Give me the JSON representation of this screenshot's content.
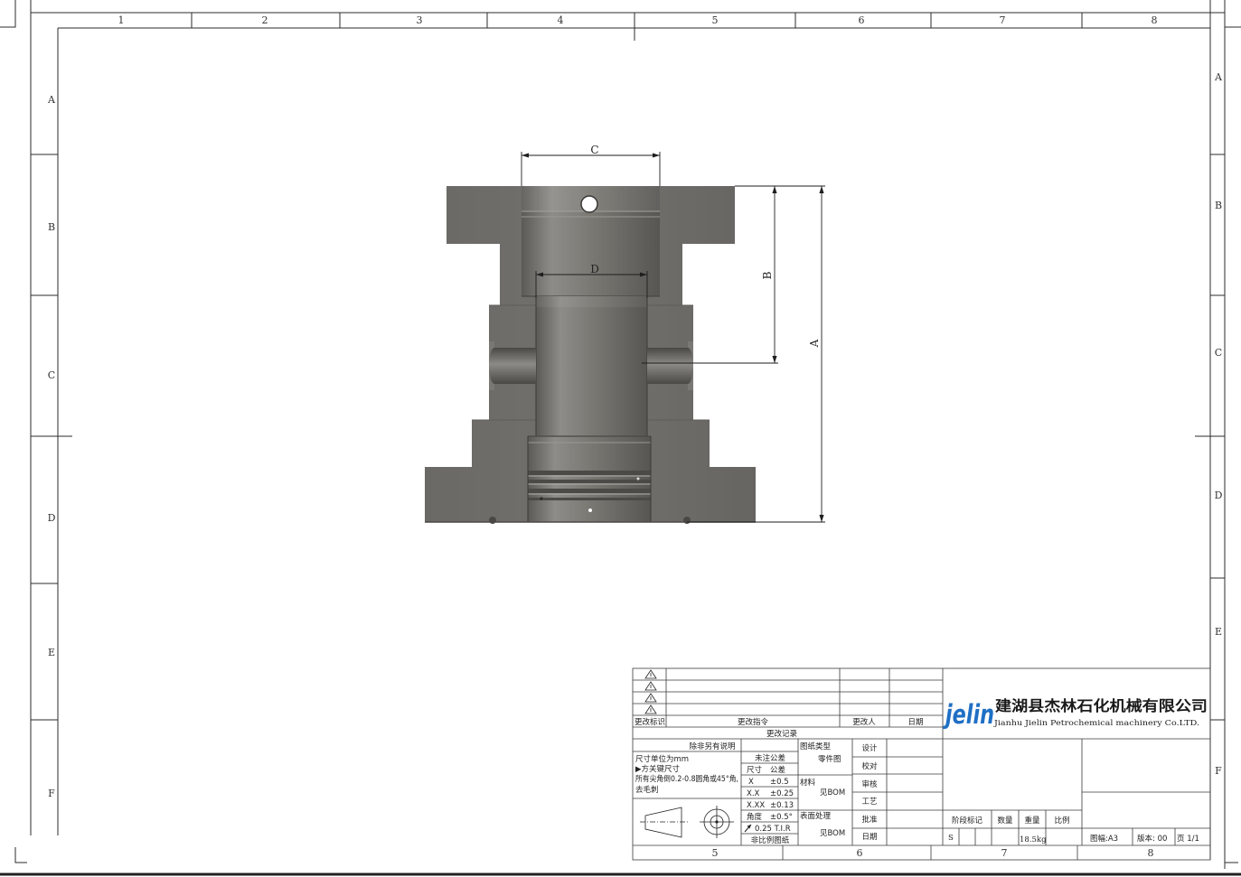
{
  "sheet": {
    "zones_top": [
      "1",
      "2",
      "3",
      "4",
      "5",
      "6",
      "7",
      "8"
    ],
    "zones_left": [
      "A",
      "B",
      "C",
      "D",
      "E",
      "F"
    ],
    "zones_right": [
      "A",
      "B",
      "C",
      "D",
      "E",
      "F"
    ],
    "zones_bottom": [
      "5",
      "6",
      "7",
      "8"
    ]
  },
  "dimensions": {
    "a": "A",
    "b": "B",
    "c": "C",
    "d": "D"
  },
  "colors": {
    "logo": "#1f6fc5",
    "part_body": "#6e6c69",
    "line": "#2b2b2b"
  },
  "title_block": {
    "rev_headers": [
      "更改标识",
      "更改指令",
      "更改人",
      "日期"
    ],
    "rev_title": "更改记录",
    "notes_header": "除非另有说明",
    "notes": [
      "尺寸单位为mm",
      "▶方关键尺寸",
      "所有尖角倒0.2-0.8圆角或45°角,",
      "去毛刺"
    ],
    "tolerance_header": "未注公差",
    "tolerance_cols": [
      "尺寸",
      "公差"
    ],
    "tolerances": [
      [
        "X",
        "±0.5"
      ],
      [
        "X.X",
        "±0.25"
      ],
      [
        "X.XX",
        "±0.13"
      ],
      [
        "角度",
        "±0.5°"
      ]
    ],
    "runout": "0.25 T.I.R",
    "not_to_scale": "非比例图纸",
    "drawing_type_label": "图纸类型",
    "drawing_type": "零件图",
    "material_label": "材料",
    "material": "见BOM",
    "surface_label": "表面处理",
    "surface": "见BOM",
    "approvals": [
      "设计",
      "校对",
      "审核",
      "工艺",
      "批准",
      "日期"
    ],
    "logo_text": "jelin",
    "company_cn": "建湖县杰林石化机械有限公司",
    "company_en": "Jianhu Jielin Petrochemical machinery Co.LTD.",
    "stage_label": "阶段标记",
    "qty_label": "数量",
    "weight_label": "重量",
    "scale_label": "比例",
    "stage": "S",
    "weight": "18.5kg",
    "format": "图幅:A3",
    "version": "版本: 00",
    "page": "页 1/1"
  }
}
